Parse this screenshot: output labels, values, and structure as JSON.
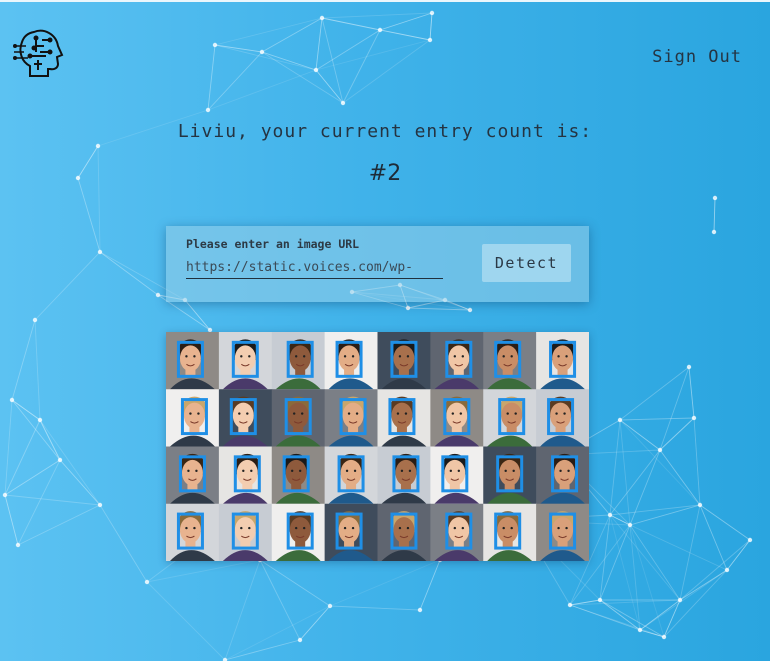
{
  "nav": {
    "logo_icon": "brain-circuit-head-icon",
    "signout_label": "Sign Out"
  },
  "rank": {
    "message": "Liviu, your current entry count is:",
    "count": "#2"
  },
  "form": {
    "label": "Please enter an image URL",
    "input_value": "https://static.voices.com/wp-",
    "detect_label": "Detect"
  },
  "colors": {
    "background_start": "#5cc2f2",
    "background_end": "#2aa5df",
    "face_box": "#1f8fe6"
  }
}
